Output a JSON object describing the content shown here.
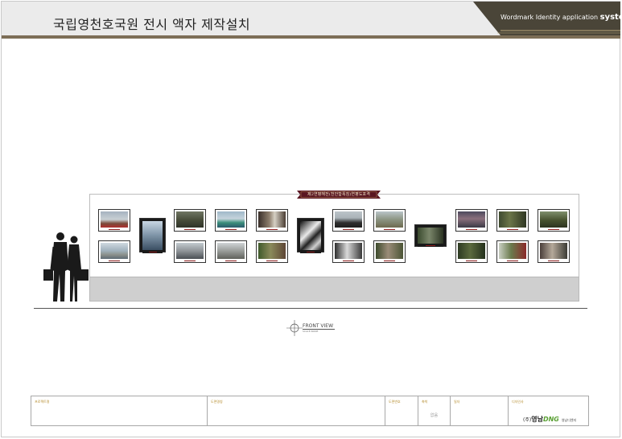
{
  "header": {
    "title": "국립영천호국원 전시 액자 제작설치",
    "system_prefix": "Wordmark Identity application ",
    "system_bold": "system"
  },
  "colors": {
    "header_band": "#7d6e57",
    "header_dark": "#4a4538",
    "title_plate": "#5a1622",
    "photo_caption": "#8a1a1a",
    "logo_green": "#5aa034"
  },
  "wall": {
    "title": "제2연평해전(천안함폭침)연평도포격"
  },
  "drawing": {
    "front_view_label": "FRONT VIEW",
    "scale_label": "SCALE:NONE"
  },
  "footer": {
    "cells": [
      {
        "label": "프로젝트명",
        "value": ""
      },
      {
        "label": "도면명칭",
        "value": ""
      },
      {
        "label": "도면번호",
        "value": ""
      },
      {
        "label": "축척",
        "value": "없음"
      },
      {
        "label": "일자",
        "value": ""
      },
      {
        "label": "디자인사",
        "value": ""
      }
    ],
    "logo_prefix": "(주)",
    "logo_main": "영남",
    "logo_dng": "DNG",
    "logo_sub": "영남디엔지"
  }
}
